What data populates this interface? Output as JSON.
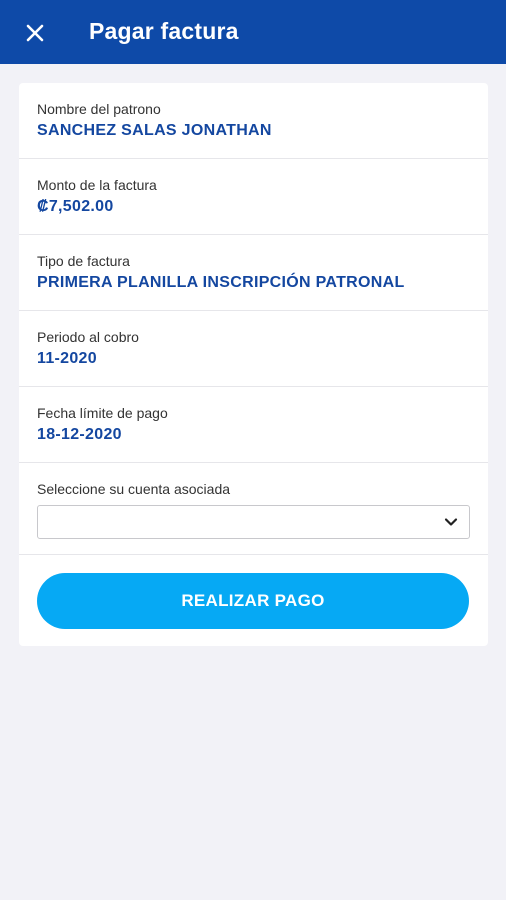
{
  "header": {
    "title": "Pagar factura",
    "close_icon": "close-icon",
    "background_color": "#0e4aa8"
  },
  "invoice": {
    "employer": {
      "label": "Nombre del patrono",
      "value": "SANCHEZ SALAS JONATHAN"
    },
    "amount": {
      "label": "Monto de la factura",
      "value": "₡7,502.00"
    },
    "type": {
      "label": "Tipo de factura",
      "value": "PRIMERA PLANILLA INSCRIPCIÓN PATRONAL"
    },
    "period": {
      "label": "Periodo al cobro",
      "value": "11-2020"
    },
    "due_date": {
      "label": "Fecha límite de pago",
      "value": "18-12-2020"
    },
    "account": {
      "label": "Seleccione su cuenta asociada",
      "selected": "",
      "icon": "chevron-down-icon"
    }
  },
  "actions": {
    "pay_label": "REALIZAR PAGO",
    "pay_color": "#06a9f4"
  },
  "colors": {
    "value_text": "#1447a0",
    "page_background": "#f2f2f7"
  }
}
